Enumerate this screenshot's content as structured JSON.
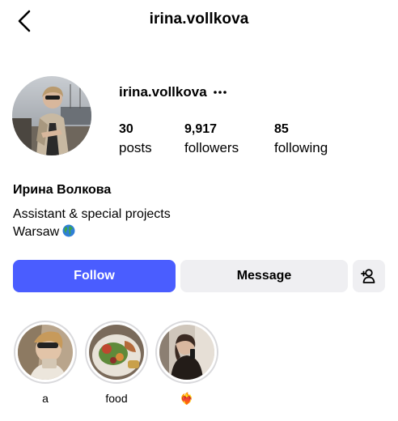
{
  "header": {
    "title": "irina.vollkova",
    "back_icon": "chevron-left-icon"
  },
  "profile": {
    "username": "irina.vollkova",
    "more_icon": "more-horizontal-icon",
    "stats": [
      {
        "value": "30",
        "label": "posts"
      },
      {
        "value": "9,917",
        "label": "followers"
      },
      {
        "value": "85",
        "label": "following"
      }
    ],
    "full_name": "Ирина Волкова",
    "bio_lines": [
      "Assistant & special projects",
      "Warsaw"
    ],
    "bio_emoji": "globe-icon"
  },
  "actions": {
    "follow_label": "Follow",
    "message_label": "Message",
    "add_user_icon": "person-add-icon",
    "accent_color": "#4a5dff"
  },
  "highlights": [
    {
      "label": "a"
    },
    {
      "label": "food"
    },
    {
      "label": "❤️‍🔥"
    }
  ]
}
